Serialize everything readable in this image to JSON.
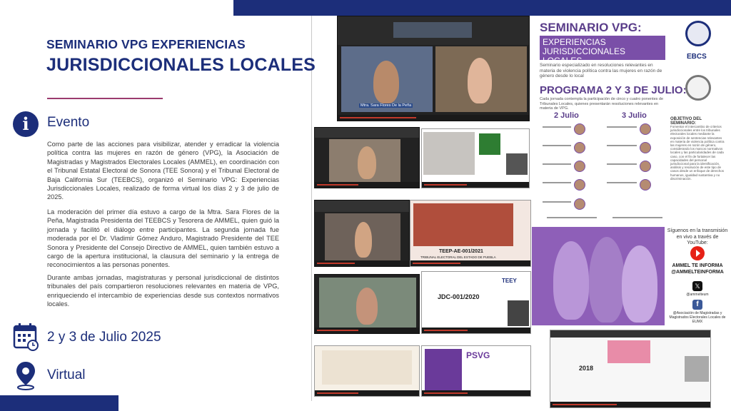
{
  "header": {
    "title_line1": "SEMINARIO VPG EXPERIENCIAS",
    "title_line2": "JURISDICCIONALES LOCALES"
  },
  "event": {
    "heading": "Evento",
    "icon": "info-icon",
    "paragraphs": [
      "Como parte de las acciones para visibilizar, atender y erradicar la violencia política contra las mujeres en razón de género (VPG), la Asociación de Magistradas y Magistrados Electorales Locales (AMMEL), en coordinación con el Tribunal Estatal Electoral de Sonora (TEE Sonora) y el Tribunal Electoral de Baja California Sur (TEEBCS), organizó el Seminario VPG: Experiencias Jurisdiccionales Locales, realizado de forma virtual los días 2 y 3 de julio de 2025.",
      "La moderación del primer día estuvo a cargo de la Mtra. Sara Flores de la Peña, Magistrada Presidenta del TEEBCS y Tesorera de AMMEL, quien guió la jornada y facilitó el diálogo entre participantes. La segunda jornada fue moderada por el Dr. Vladimir Gómez Anduro, Magistrado Presidente del TEE Sonora y Presidente del Consejo Directivo de AMMEL, quien también estuvo a cargo de la apertura institucional, la clausura del seminario y la entrega de reconocimientos a las personas ponentes.",
      "Durante ambas jornadas, magistraturas y personal jurisdiccional de distintos tribunales del país compartieron resoluciones relevantes en materia de VPG, enriqueciendo el intercambio de experiencias desde sus contextos normativos locales."
    ]
  },
  "date": {
    "icon": "calendar-icon",
    "text": "2 y 3 de Julio 2025"
  },
  "place": {
    "icon": "location-pin-icon",
    "text": "Virtual"
  },
  "poster": {
    "title": "SEMINARIO VPG:",
    "subtitle": "EXPERIENCIAS JURISDICCIONALES LOCALES",
    "description": "Seminario especializado en resoluciones relevantes en materia de violencia política contra las mujeres en razón de género desde lo local",
    "program": "PROGRAMA 2 Y 3 DE JULIO:",
    "program_desc": "Cada jornada contempla la participación de cinco y cuatro ponentes de Tribunales Locales, quienes presentarán resoluciones relevantes en materia de VPG.",
    "day1": "2 Julio",
    "day2": "3 Julio",
    "objective_title": "OBJETIVO DEL SEMINARIO:",
    "objective_text": "Fomentar el intercambio de criterios jurisdiccionales entre los tribunales electorales locales mediante la exposición de sentencias relevantes en materia de violencia política contra las mujeres en razón de género, considerando los marcos normativos locales y las particularidades de cada caso, con el fin de fortalecer las capacidades del personal jurisdiccional para la identificación, análisis y resolución de este tipo de casos desde un enfoque de derechos humanos, igualdad sustantiva y no discriminación.",
    "ebcs": "EBCS"
  },
  "social": {
    "follow_text": "Síguenos en la transmisión en vivo a través de YouTube:",
    "channel": "AMMEL TE INFORMA",
    "handle": "@AMMELTEINFORMA",
    "x_handle": "@ammelteum",
    "facebook": "@Asociación de Magistradas y Magistrados Electorales Locales de EUMX"
  },
  "screens": {
    "cap1": "Mtra. Sara Flores De la Peña",
    "slide_teep": "TEEP-AE-001/2021",
    "slide_teep_sub": "TRIBUNAL ELECTORAL DEL ESTADO DE PUEBLA",
    "slide_jdc": "JDC-001/2020",
    "slide_teey": "TEEY",
    "slide_psvg": "PSVG",
    "slide_2018": "2018"
  },
  "colors": {
    "primary": "#1c2e7a",
    "accent": "#9b3a6e",
    "purple": "#7a4fa8"
  }
}
